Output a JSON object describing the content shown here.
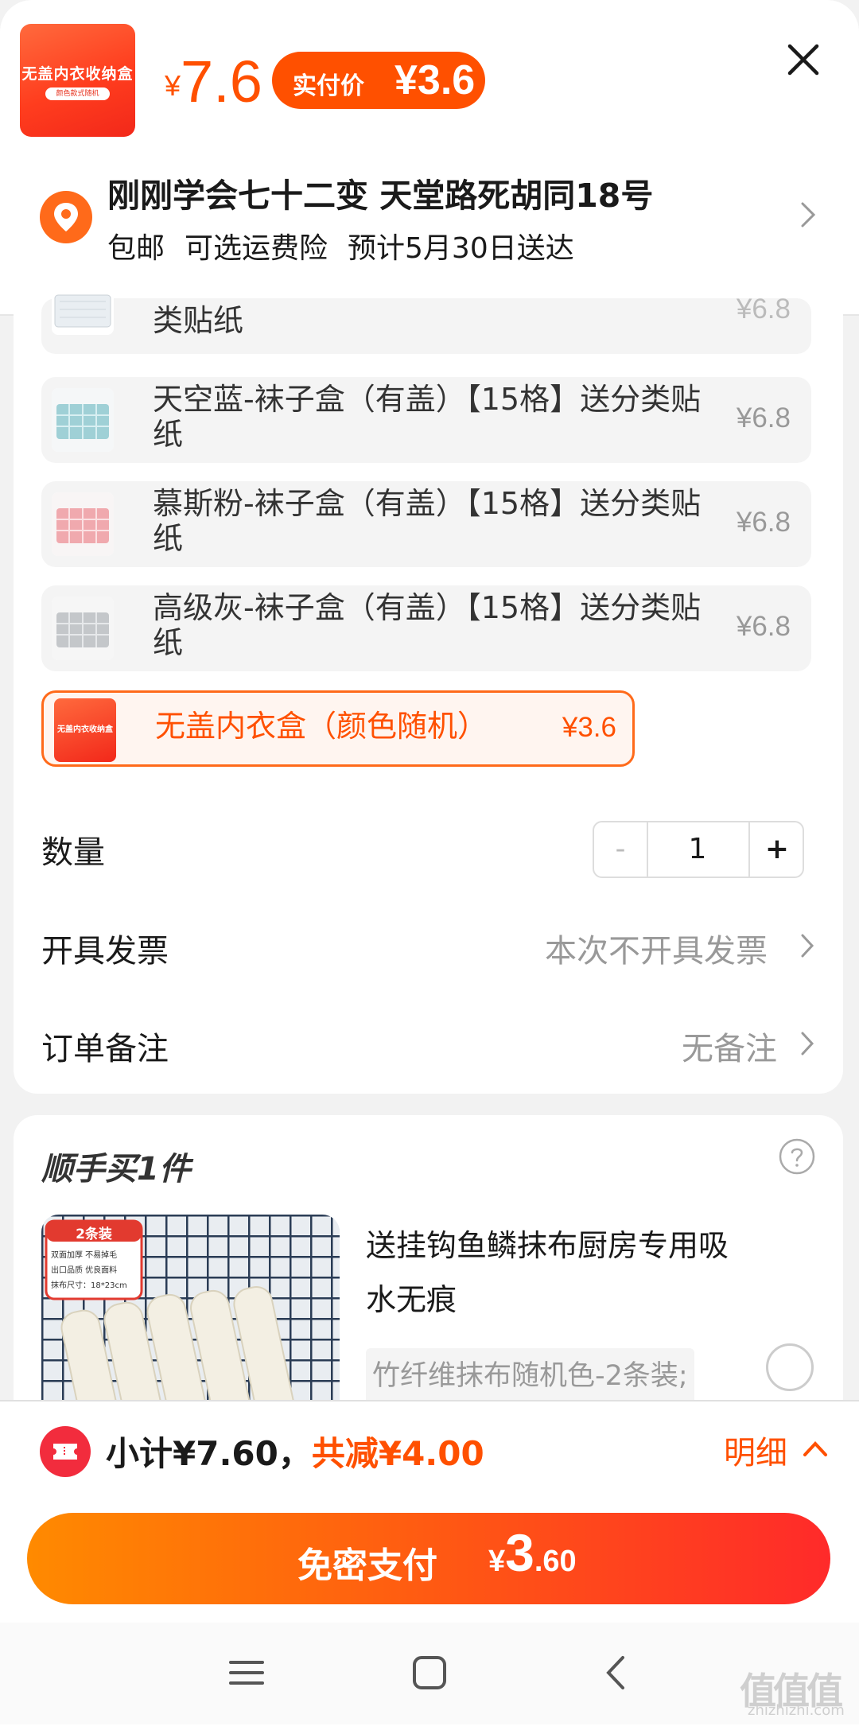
{
  "header": {
    "thumb_title": "无盖内衣收纳盒",
    "thumb_sub": "颜色款式随机",
    "price_symbol": "¥",
    "price": "7.6",
    "paid_label": "实付价",
    "paid_value": "¥3.6",
    "address": "刚刚学会七十二变 天堂路死胡同18号",
    "shipping": [
      "包邮",
      "可选运费险",
      "预计5月30日送达"
    ]
  },
  "variants": [
    {
      "name": "类贴纸",
      "price": "¥6.8",
      "selected": false
    },
    {
      "name": "天空蓝-袜子盒（有盖）【15格】送分类贴纸",
      "price": "¥6.8",
      "selected": false
    },
    {
      "name": "慕斯粉-袜子盒（有盖）【15格】送分类贴纸",
      "price": "¥6.8",
      "selected": false
    },
    {
      "name": "高级灰-袜子盒（有盖）【15格】送分类贴纸",
      "price": "¥6.8",
      "selected": false
    },
    {
      "name": "无盖内衣盒（颜色随机）",
      "price": "¥3.6",
      "selected": true,
      "thumb_text": "无盖内衣收纳盒"
    }
  ],
  "quantity": {
    "label": "数量",
    "minus": "-",
    "value": "1",
    "plus": "+"
  },
  "invoice": {
    "label": "开具发票",
    "value": "本次不开具发票"
  },
  "note": {
    "label": "订单备注",
    "value": "无备注"
  },
  "addon": {
    "title": "顺手买1件",
    "badge": "2条装",
    "badge_lines": [
      "双面加厚 不易掉毛",
      "出口品质 优良面料",
      "抹布尺寸：18*23cm"
    ],
    "name": "送挂钩鱼鳞抹布厨房专用吸水无痕",
    "sku": "竹纤维抹布随机色-2条装;"
  },
  "summary": {
    "subtotal": "小计¥7.60，",
    "discount": "共减¥4.00",
    "detail": "明细",
    "pay_label": "免密支付",
    "pay_symbol": "¥",
    "pay_int": "3",
    "pay_dec": ".60"
  },
  "watermark": {
    "main": "值值值",
    "sub": "zhizhizhi.com"
  },
  "colors": {
    "accent": "#ff5000",
    "background": "#f2f2f2"
  }
}
